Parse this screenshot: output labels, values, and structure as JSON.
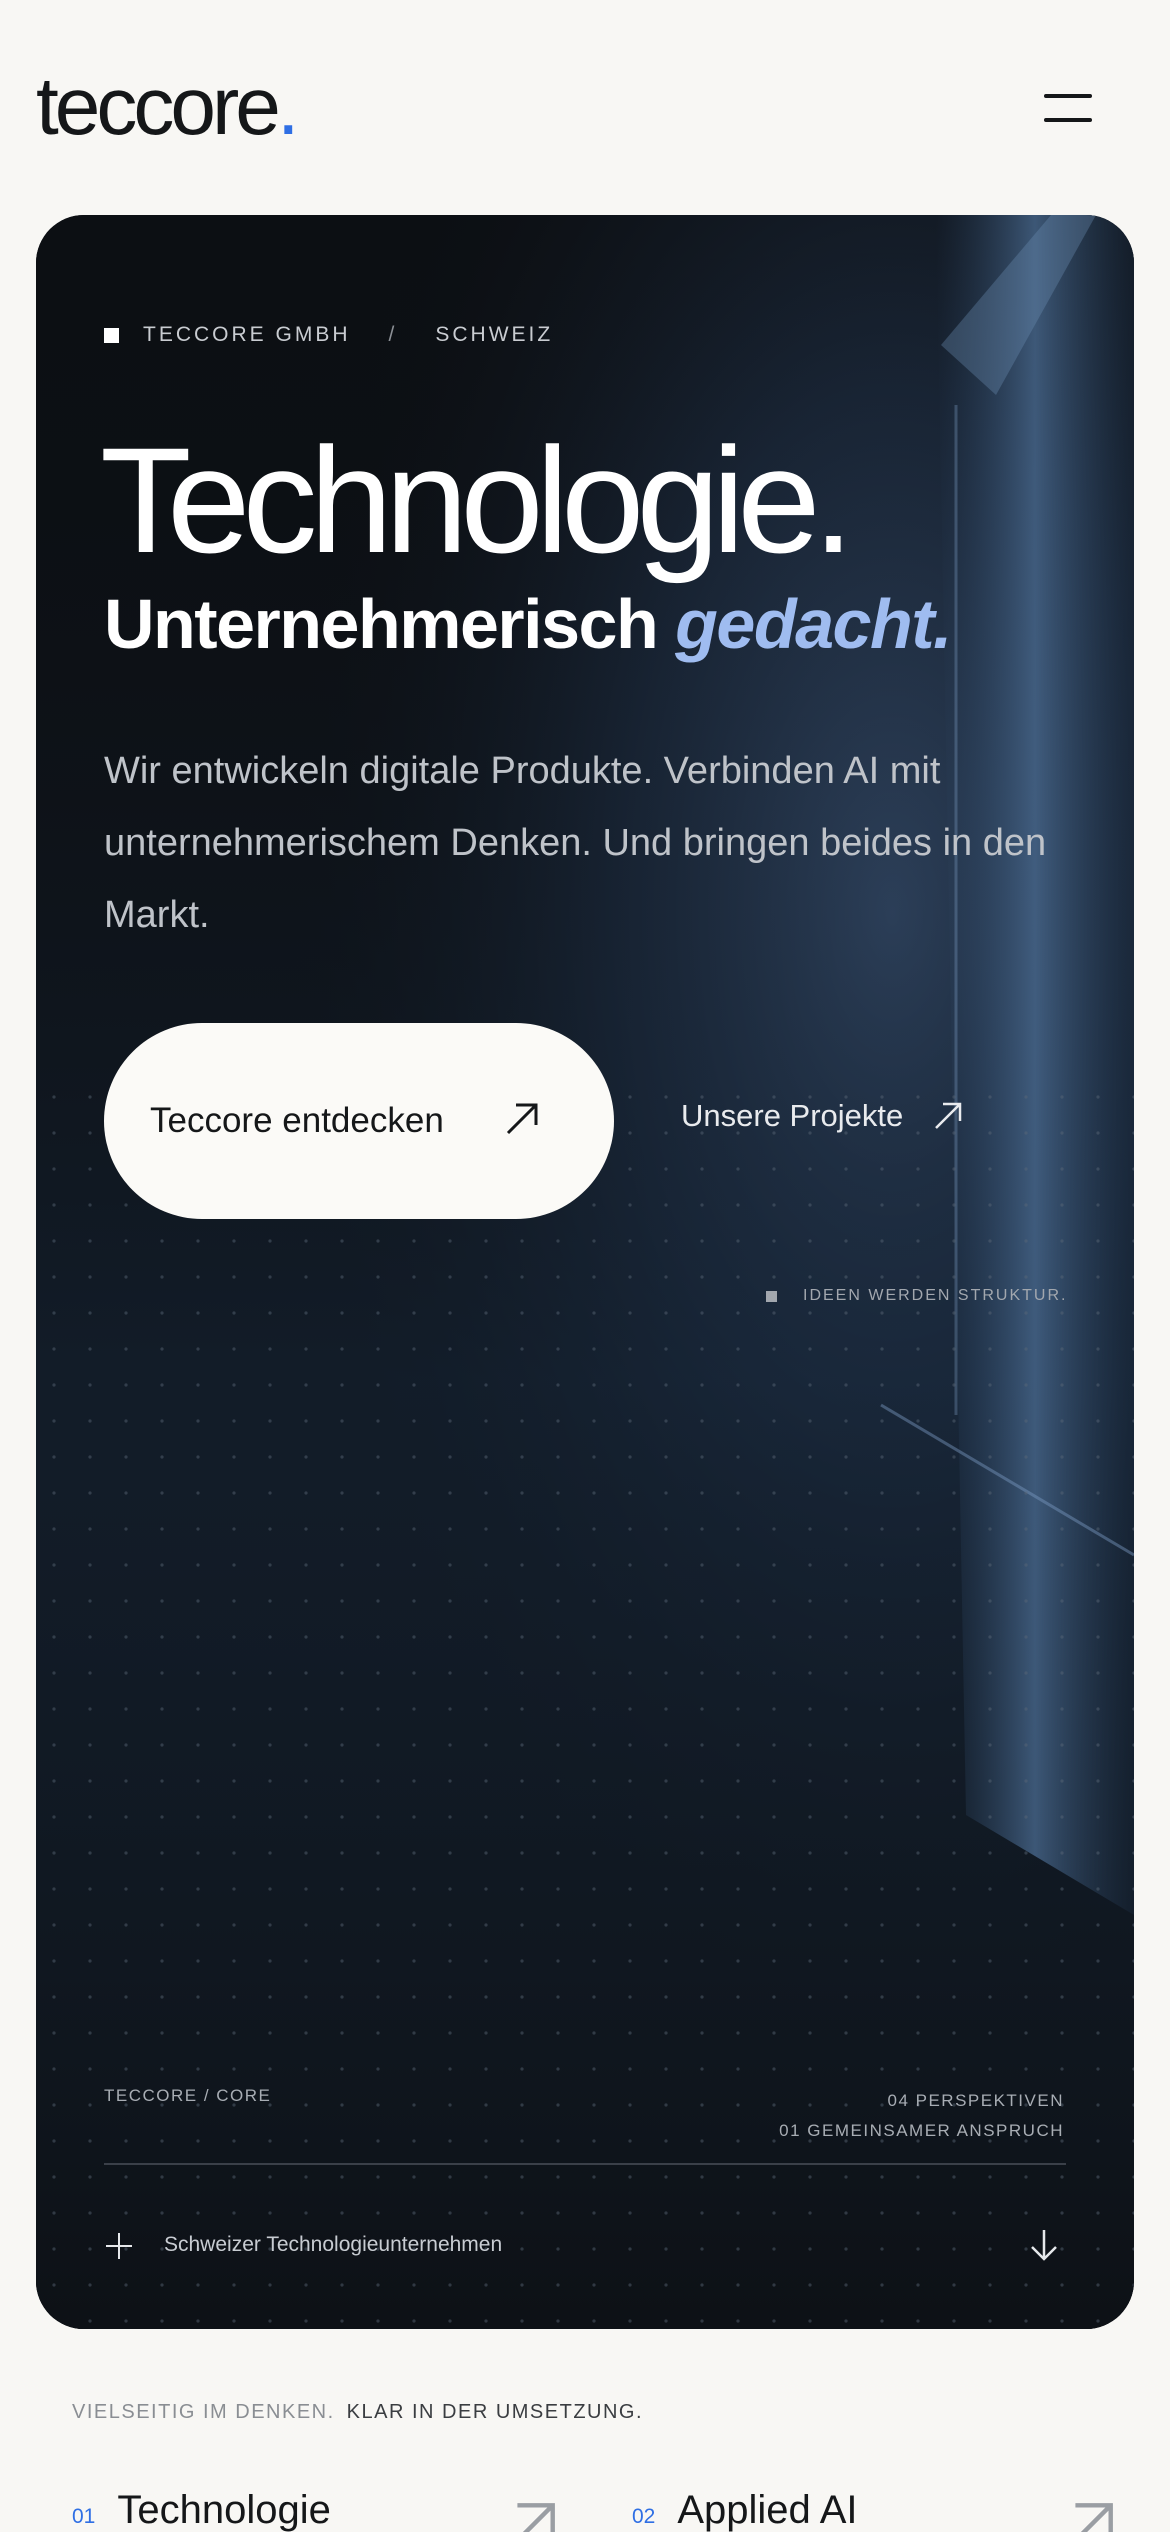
{
  "header": {
    "logo_text": "teccore",
    "logo_dot": ".",
    "menu_icon": "hamburger-menu-icon"
  },
  "hero": {
    "eyebrow": {
      "company": "TECCORE GMBH",
      "separator": "/",
      "country": "SCHWEIZ"
    },
    "title": "Technologie.",
    "subtitle_plain": "Unternehmerisch ",
    "subtitle_accent": "gedacht.",
    "lead": "Wir entwickeln digitale Produkte. Verbinden AI mit unternehmerischem Denken. Und bringen beides in den Markt.",
    "primary_button": "Teccore entdecken",
    "secondary_link": "Unsere Projekte",
    "tag": "IDEEN WERDEN STRUKTUR.",
    "footer_left": "TECCORE / CORE",
    "footer_right_1": "04 PERSPEKTIVEN",
    "footer_right_2": "01 GEMEINSAMER ANSPRUCH",
    "footer_label": "Schweizer Technologieunternehmen",
    "colors": {
      "accent_blue": "#2f6fe4",
      "accent_soft": "#9fbcf0",
      "card_bg": "#0c0f13"
    }
  },
  "intro": {
    "tagline_light": "VIELSEITIG IM DENKEN.",
    "tagline_strong": "KLAR IN DER UMSETZUNG."
  },
  "services": [
    {
      "num": "01",
      "name": "Technologie"
    },
    {
      "num": "02",
      "name": "Applied AI"
    }
  ]
}
